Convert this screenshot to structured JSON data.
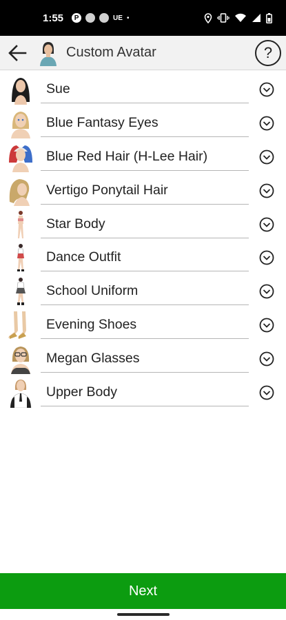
{
  "status_bar": {
    "time": "1:55",
    "notif_p": "P",
    "notif_ue": "UE",
    "notif_dot": "•",
    "icons": [
      "location-icon",
      "vibrate-icon",
      "wifi-icon",
      "signal-icon",
      "battery-icon"
    ]
  },
  "app_bar": {
    "title": "Custom Avatar",
    "help_label": "?"
  },
  "items": [
    {
      "label": "Sue",
      "thumb": "hair-black"
    },
    {
      "label": "Blue Fantasy Eyes",
      "thumb": "face-blonde"
    },
    {
      "label": "Blue Red Hair (H-Lee Hair)",
      "thumb": "hair-blue-red"
    },
    {
      "label": "Vertigo Ponytail Hair",
      "thumb": "hair-blonde-ponytail"
    },
    {
      "label": "Star Body",
      "thumb": "body-figure"
    },
    {
      "label": "Dance Outfit",
      "thumb": "outfit-figure"
    },
    {
      "label": "School Uniform",
      "thumb": "uniform-figure"
    },
    {
      "label": "Evening Shoes",
      "thumb": "shoes"
    },
    {
      "label": "Megan Glasses",
      "thumb": "face-glasses"
    },
    {
      "label": "Upper Body",
      "thumb": "upper-body"
    }
  ],
  "footer": {
    "next_label": "Next"
  },
  "colors": {
    "accent_green": "#0c9c10",
    "status_bar": "#000000",
    "app_bar": "#f2f2f2"
  }
}
